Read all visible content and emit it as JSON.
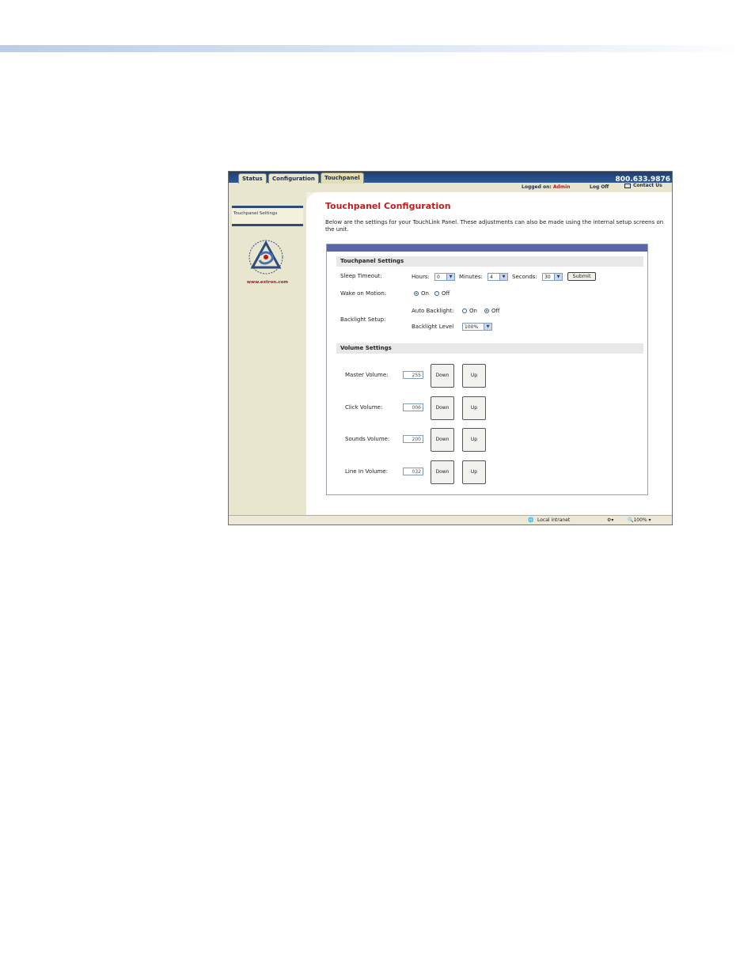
{
  "browser": {
    "tabs": [
      "Status",
      "Configuration",
      "Touchpanel"
    ],
    "active_tab": "Touchpanel",
    "phone": "800.633.9876",
    "logged_on_label": "Logged on:",
    "user": "Admin",
    "log_off": "Log Off",
    "contact_us": "Contact Us"
  },
  "sidebar": {
    "menu_item": "Touchpanel Settings",
    "website": "www.extron.com",
    "logo_icon": "extron-logo-icon"
  },
  "main": {
    "title": "Touchpanel Configuration",
    "description": "Below are the settings for your TouchLink Panel. These adjustments can also be made using the internal setup screens on the unit."
  },
  "touchpanel_settings": {
    "heading": "Touchpanel Settings",
    "sleep_timeout_label": "Sleep Timeout:",
    "hours_label": "Hours:",
    "hours_value": "0",
    "minutes_label": "Minutes:",
    "minutes_value": "4",
    "seconds_label": "Seconds:",
    "seconds_value": "30",
    "submit": "Submit",
    "wake_label": "Wake on Motion:",
    "wake_on": "On",
    "wake_off": "Off",
    "wake_selected": "On",
    "backlight_label": "Backlight Setup:",
    "auto_backlight_label": "Auto Backlight:",
    "auto_on": "On",
    "auto_off": "Off",
    "auto_selected": "Off",
    "backlight_level_label": "Backlight Level",
    "backlight_level_value": "100%"
  },
  "volume_settings": {
    "heading": "Volume Settings",
    "rows": [
      {
        "label": "Master Volume:",
        "value": "255",
        "down": "Down",
        "up": "Up"
      },
      {
        "label": "Click Volume:",
        "value": "006",
        "down": "Down",
        "up": "Up"
      },
      {
        "label": "Sounds Volume:",
        "value": "200",
        "down": "Down",
        "up": "Up"
      },
      {
        "label": "Line In Volume:",
        "value": "032",
        "down": "Down",
        "up": "Up"
      }
    ]
  },
  "statusbar": {
    "zone": "Local intranet",
    "zoom": "100%"
  }
}
